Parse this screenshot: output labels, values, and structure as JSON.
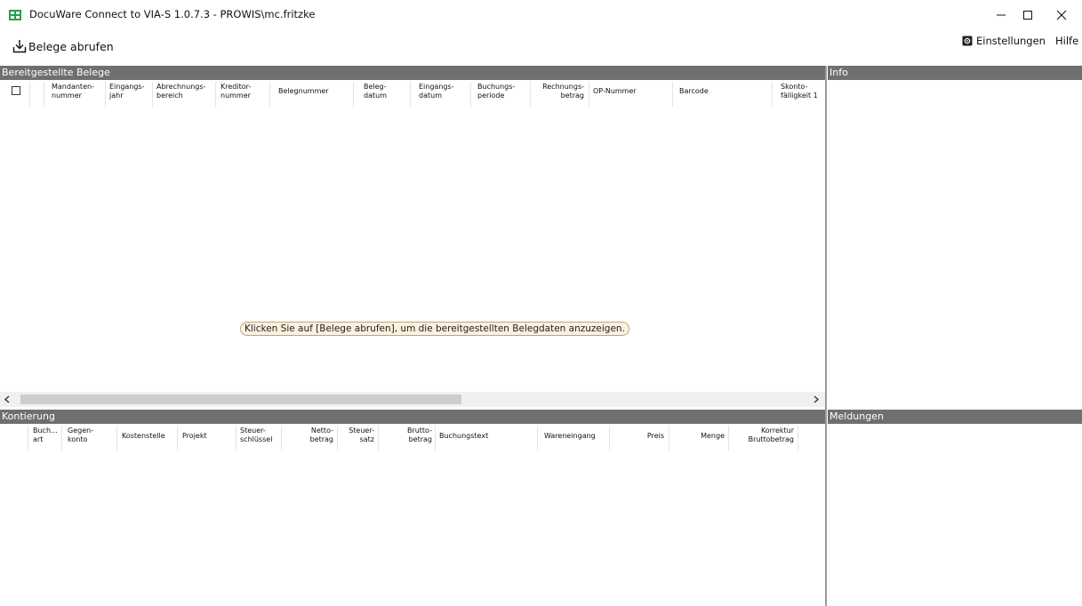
{
  "window": {
    "title": "DocuWare Connect to VIA-S 1.0.7.3 - PROWIS\\mc.fritzke"
  },
  "toolbar": {
    "fetch_label": "Belege abrufen",
    "settings_label": "Einstellungen",
    "help_label": "Hilfe"
  },
  "belege": {
    "title": "Bereitgestellte Belege",
    "columns": [
      "Mandanten-\nnummer",
      "Eingangs-\njahr",
      "Abrechnungs-\nbereich",
      "Kreditor-\nnummer",
      "Belegnummer",
      "Beleg-\ndatum",
      "Eingangs-\ndatum",
      "Buchungs-\nperiode",
      "Rechnungs-\nbetrag",
      "OP-Nummer",
      "Barcode",
      "Skonto-\nfälligkeit 1"
    ],
    "empty_hint": "Klicken Sie auf [Belege abrufen], um die bereitgestellten Belegdaten anzuzeigen."
  },
  "kontierung": {
    "title": "Kontierung",
    "columns": [
      "Buch...\nart",
      "Gegen-\nkonto",
      "Kostenstelle",
      "Projekt",
      "Steuer-\nschlüssel",
      "Netto-\nbetrag",
      "Steuer-\nsatz",
      "Brutto-\nbetrag",
      "Buchungstext",
      "Wareneingang",
      "Preis",
      "Menge",
      "Korrektur\nBruttobetrag"
    ]
  },
  "info": {
    "title": "Info"
  },
  "meldungen": {
    "title": "Meldungen"
  },
  "colors": {
    "panel_header": "#6f6f6f",
    "hint_border": "#c9a070",
    "hint_background": "#fbf1e0"
  },
  "icons": [
    "app-icon",
    "download-icon",
    "settings-icon",
    "minimize-icon",
    "maximize-icon",
    "close-icon",
    "scroll-left-icon",
    "scroll-right-icon"
  ]
}
